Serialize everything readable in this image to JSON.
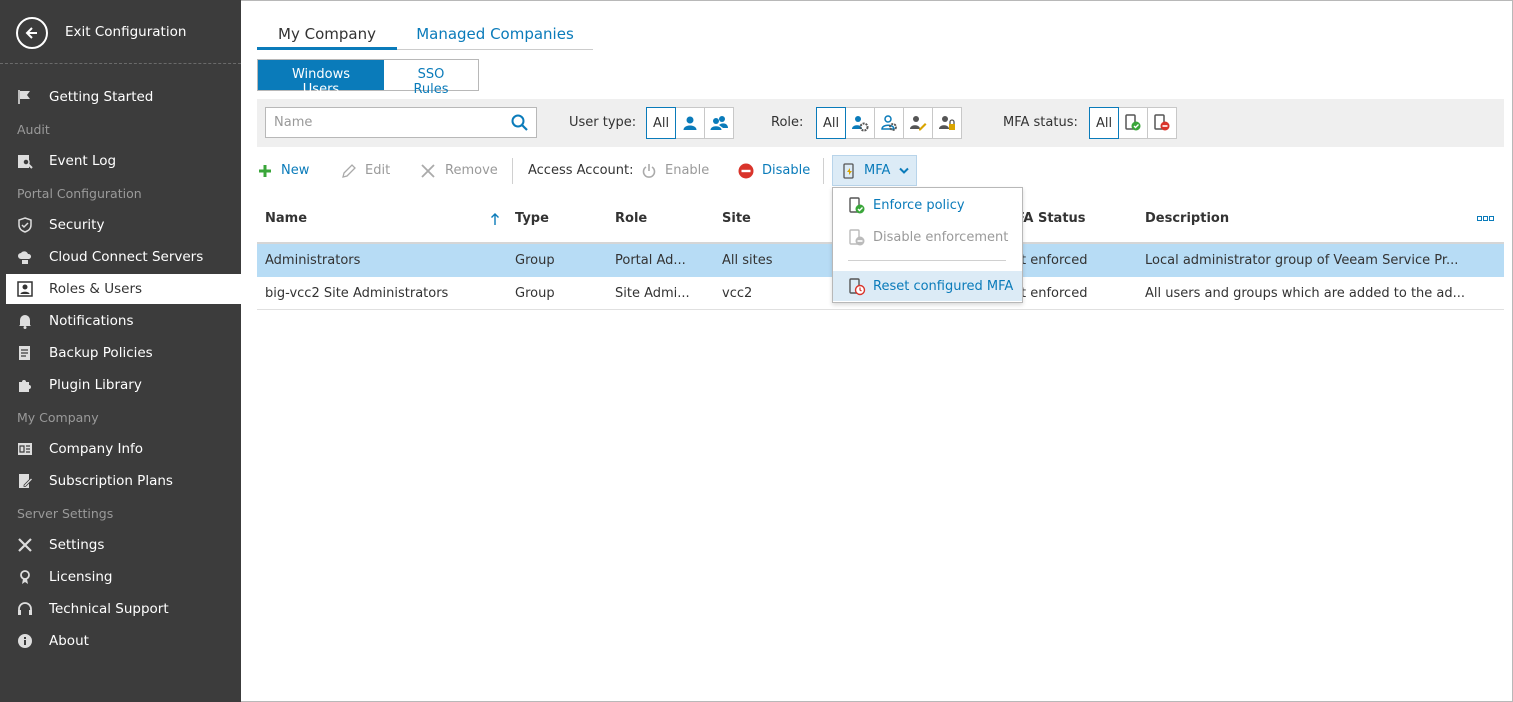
{
  "sidebar": {
    "exit_label": "Exit Configuration",
    "items": [
      {
        "label": "Getting Started",
        "icon": "flag-icon"
      },
      {
        "section": "Audit"
      },
      {
        "label": "Event Log",
        "icon": "event-log-icon"
      },
      {
        "section": "Portal Configuration"
      },
      {
        "label": "Security",
        "icon": "shield-icon"
      },
      {
        "label": "Cloud Connect Servers",
        "icon": "cloud-server-icon"
      },
      {
        "label": "Roles & Users",
        "icon": "user-card-icon",
        "active": true
      },
      {
        "label": "Notifications",
        "icon": "bell-icon"
      },
      {
        "label": "Backup Policies",
        "icon": "policy-icon"
      },
      {
        "label": "Plugin Library",
        "icon": "puzzle-icon"
      },
      {
        "section": "My Company"
      },
      {
        "label": "Company Info",
        "icon": "company-icon"
      },
      {
        "label": "Subscription Plans",
        "icon": "plans-icon"
      },
      {
        "section": "Server Settings"
      },
      {
        "label": "Settings",
        "icon": "tools-icon"
      },
      {
        "label": "Licensing",
        "icon": "license-icon"
      },
      {
        "label": "Technical Support",
        "icon": "headset-icon"
      },
      {
        "label": "About",
        "icon": "info-icon"
      }
    ],
    "labels": {
      "getting_started": "Getting Started",
      "audit": "Audit",
      "event_log": "Event Log",
      "portal_config": "Portal Configuration",
      "security": "Security",
      "ccs": "Cloud Connect Servers",
      "roles_users": "Roles & Users",
      "notifications": "Notifications",
      "backup_policies": "Backup Policies",
      "plugin_library": "Plugin Library",
      "my_company": "My Company",
      "company_info": "Company Info",
      "subscription_plans": "Subscription Plans",
      "server_settings": "Server Settings",
      "settings": "Settings",
      "licensing": "Licensing",
      "tech_support": "Technical Support",
      "about": "About"
    }
  },
  "tabs": {
    "my_company": "My Company",
    "managed_companies": "Managed Companies"
  },
  "subtabs": {
    "windows_users": "Windows Users",
    "sso_rules": "SSO Rules"
  },
  "filters": {
    "search_placeholder": "Name",
    "user_type_label": "User type:",
    "role_label": "Role:",
    "mfa_label": "MFA status:",
    "all": "All"
  },
  "toolbar": {
    "new": "New",
    "edit": "Edit",
    "remove": "Remove",
    "access_account": "Access Account:",
    "enable": "Enable",
    "disable": "Disable",
    "mfa": "MFA"
  },
  "table": {
    "headers": {
      "name": "Name",
      "type": "Type",
      "role": "Role",
      "site": "Site",
      "mfa_status": "FA Status",
      "description": "Description"
    },
    "rows": [
      {
        "name": "Administrators",
        "type": "Group",
        "role": "Portal Ad...",
        "site": "All sites",
        "mfa": "t enforced",
        "description": "Local administrator group of Veeam Service Pr..."
      },
      {
        "name": "big-vcc2 Site Administrators",
        "type": "Group",
        "role": "Site Admi...",
        "site": "vcc2",
        "mfa": "t enforced",
        "description": "All users and groups which are added to the ad..."
      }
    ]
  },
  "mfa_menu": {
    "enforce": "Enforce policy",
    "disable_enforcement": "Disable enforcement",
    "reset": "Reset configured MFA"
  },
  "colors": {
    "accent": "#0a7bba",
    "sidebar_bg": "#3c3c3c",
    "selected_row": "#b7dcf5"
  }
}
